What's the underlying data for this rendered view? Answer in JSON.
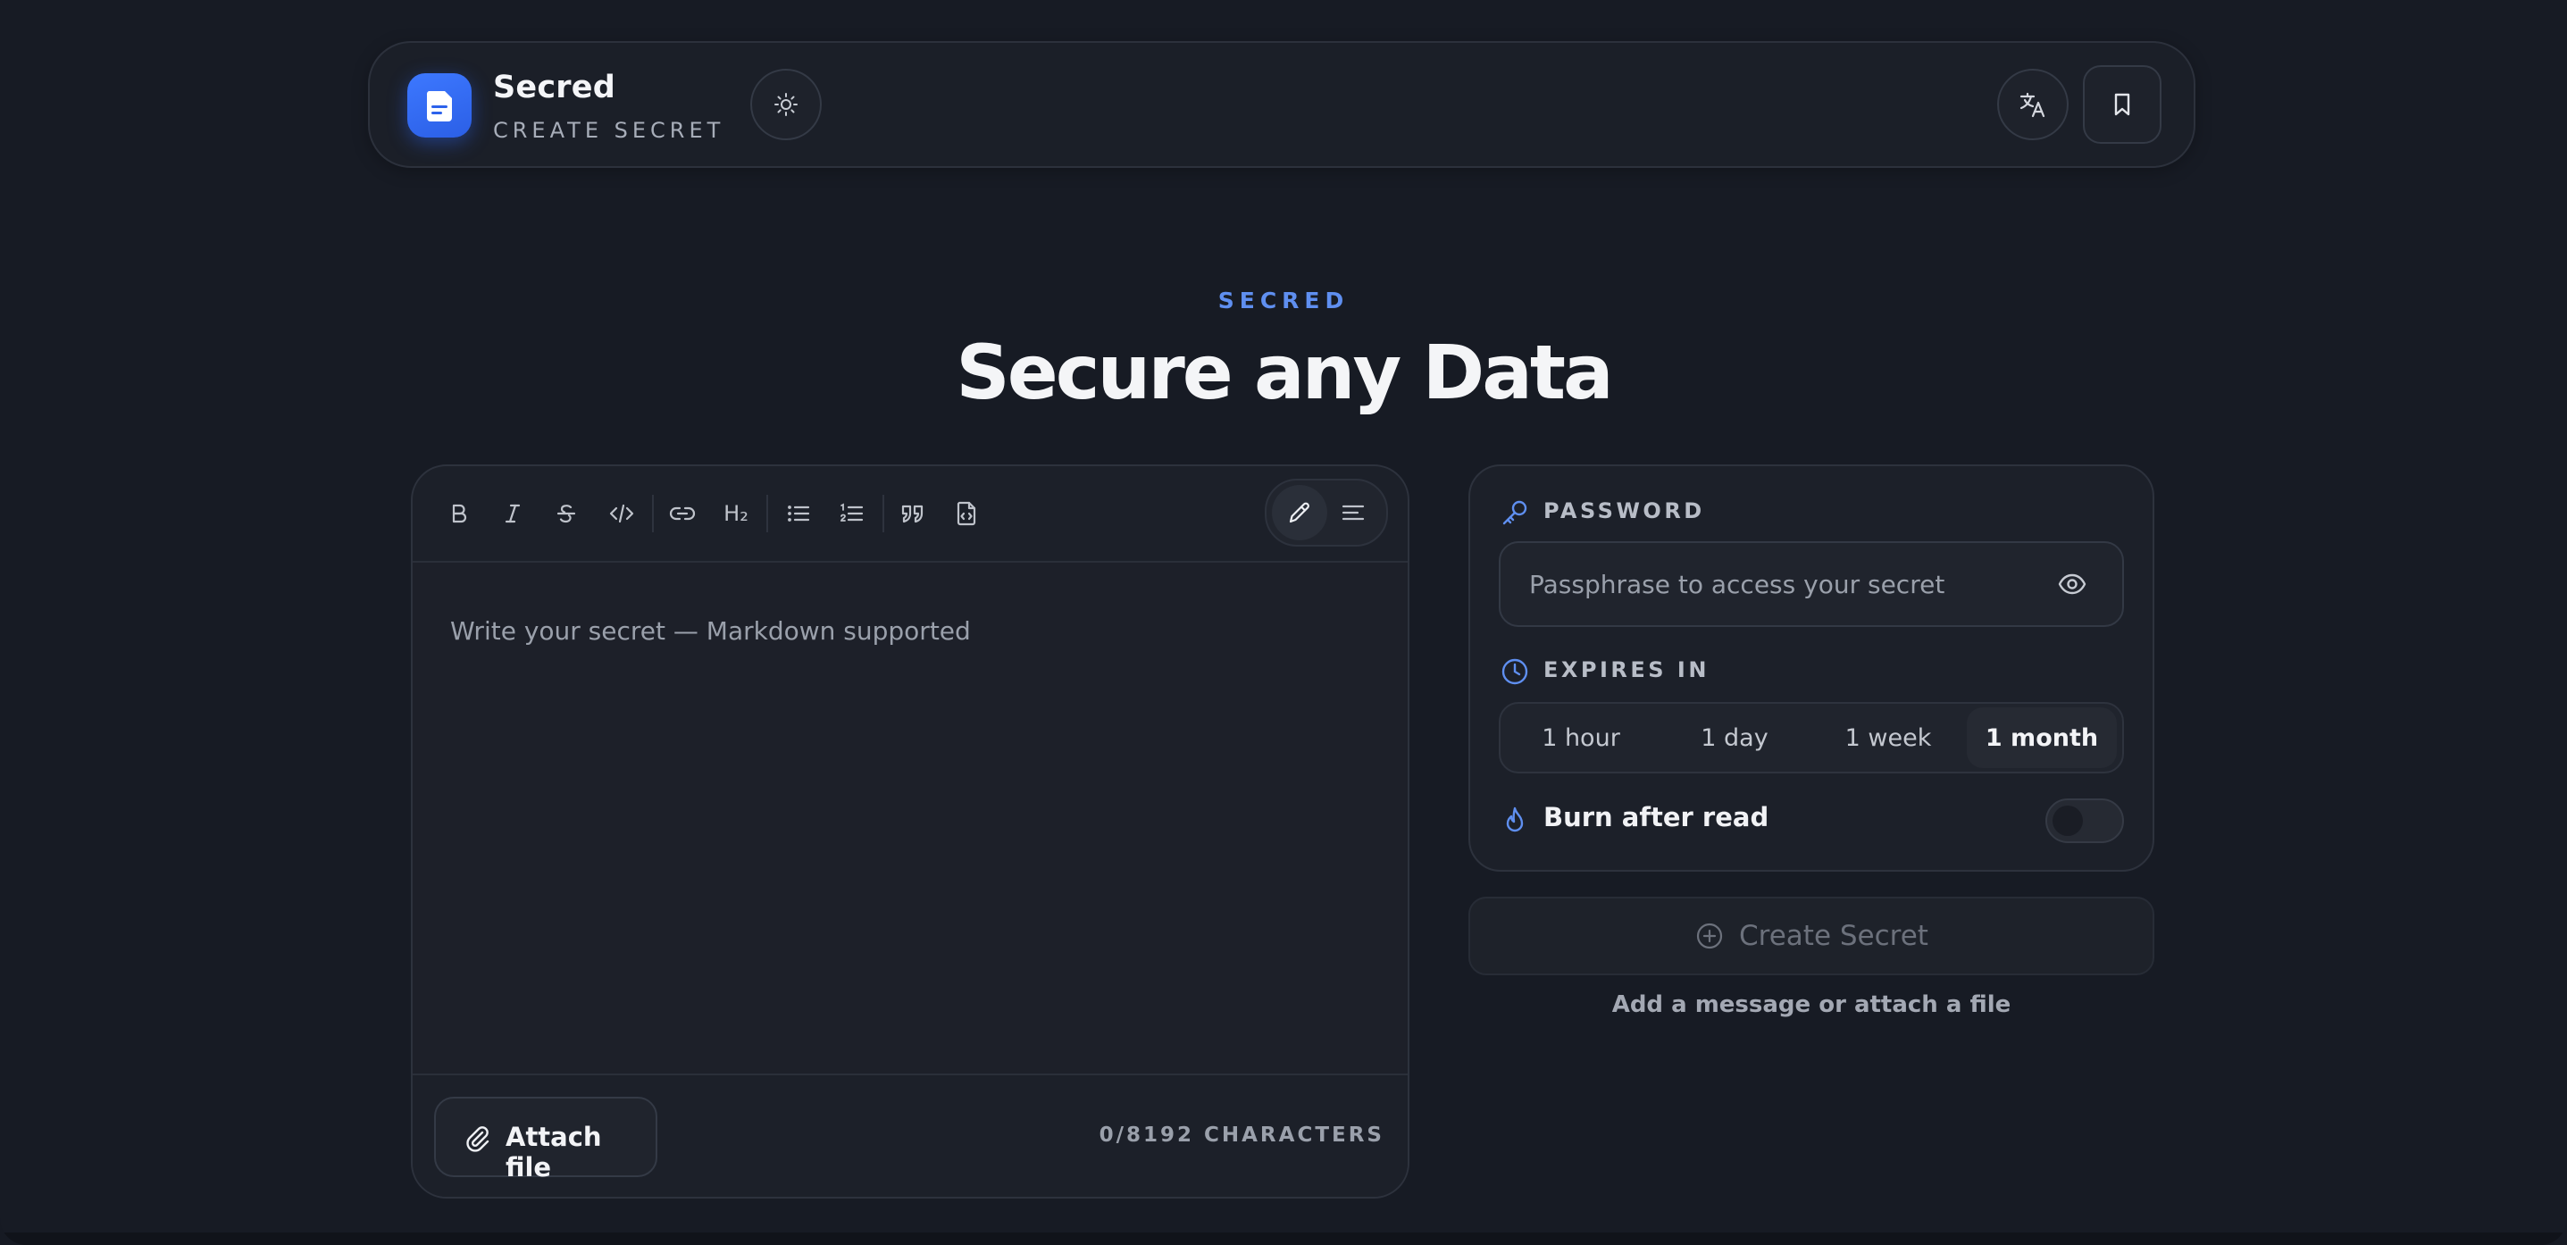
{
  "header": {
    "app_name": "Secred",
    "subtitle": "CREATE SECRET"
  },
  "hero": {
    "eyebrow": "SECRED",
    "title": "Secure any Data"
  },
  "editor": {
    "toolbar": [
      {
        "name": "bold-icon"
      },
      {
        "name": "italic-icon"
      },
      {
        "name": "strikethrough-icon"
      },
      {
        "name": "code-icon"
      },
      {
        "name": "link-icon"
      },
      {
        "name": "heading-icon"
      },
      {
        "name": "bullet-list-icon"
      },
      {
        "name": "numbered-list-icon"
      },
      {
        "name": "quote-icon"
      },
      {
        "name": "code-file-icon"
      }
    ],
    "heading_tool_label": "H₂",
    "placeholder": "Write your secret — Markdown supported",
    "attach_label": "Attach file",
    "char_count": "0/8192 CHARACTERS"
  },
  "settings": {
    "password_label": "PASSWORD",
    "password_placeholder": "Passphrase to access your secret",
    "expires_label": "EXPIRES IN",
    "expiry_options": [
      "1 hour",
      "1 day",
      "1 week",
      "1 month"
    ],
    "expiry_selected": "1 month",
    "burn_label": "Burn after read",
    "burn_enabled": false
  },
  "actions": {
    "create_label": "Create Secret",
    "hint": "Add a message or attach a file"
  },
  "colors": {
    "accent": "#5f8ff0",
    "logo": "#3d78ff",
    "background": "#171b24"
  }
}
